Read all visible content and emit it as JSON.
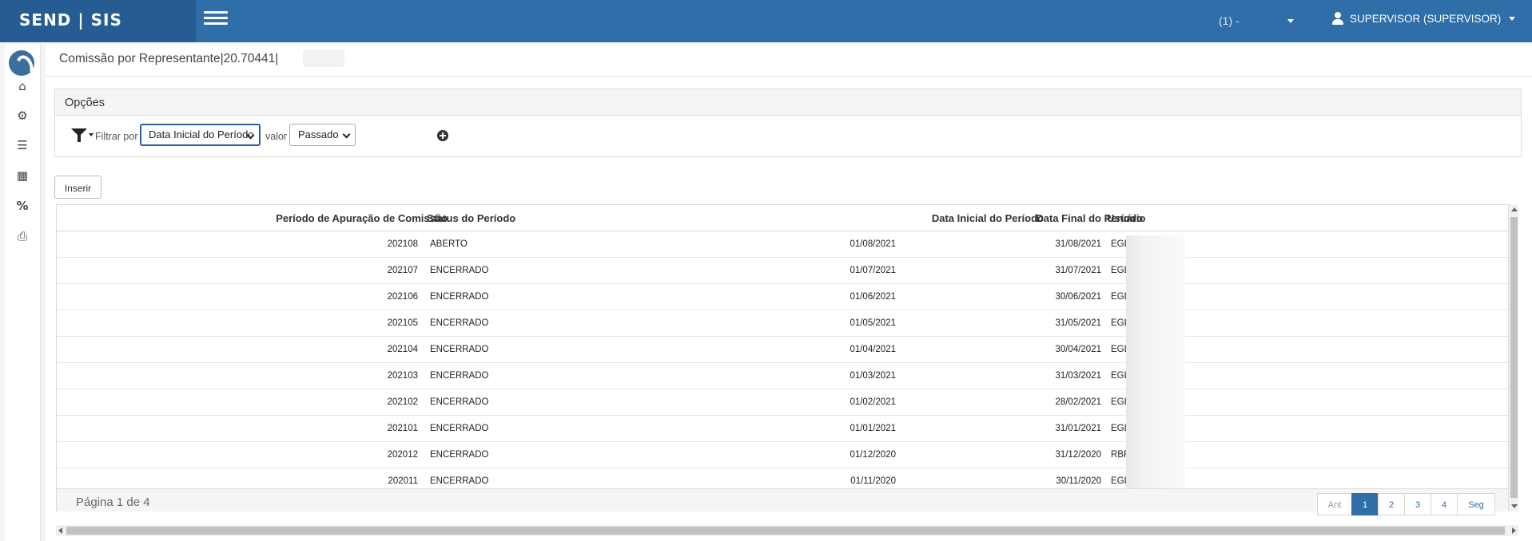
{
  "app": {
    "brand": "SEND | SIS"
  },
  "header": {
    "company": "(1) -",
    "user": "SUPERVISOR (SUPERVISOR)"
  },
  "sidebar": {
    "icons": [
      "logo-icon",
      "home-icon",
      "cogs-icon",
      "stack-icon",
      "calculator-icon",
      "percent-icon",
      "print-icon"
    ],
    "glyphs": {
      "home": "⌂",
      "cogs": "⚙",
      "stack": "☰",
      "calculator": "▦",
      "percent": "%",
      "print": "⎙"
    }
  },
  "page": {
    "title": "Comissão por Representante|20.70441|"
  },
  "options": {
    "heading": "Opções",
    "filter_label": "Filtrar por",
    "filter_field": "Data Inicial do Período",
    "value_label": "valor",
    "value_option": "Passado"
  },
  "toolbar": {
    "insert_label": "Inserir"
  },
  "table": {
    "columns": [
      "Período de Apuração de Comissão",
      "Status do Período",
      "Data Inicial do Período",
      "Data Final do Período",
      "Usuário"
    ],
    "rows": [
      {
        "periodo": "202108",
        "status": "ABERTO",
        "inicio": "01/08/2021",
        "fim": "31/08/2021",
        "usuario": "EGL"
      },
      {
        "periodo": "202107",
        "status": "ENCERRADO",
        "inicio": "01/07/2021",
        "fim": "31/07/2021",
        "usuario": "EGL"
      },
      {
        "periodo": "202106",
        "status": "ENCERRADO",
        "inicio": "01/06/2021",
        "fim": "30/06/2021",
        "usuario": "EGL"
      },
      {
        "periodo": "202105",
        "status": "ENCERRADO",
        "inicio": "01/05/2021",
        "fim": "31/05/2021",
        "usuario": "EGL"
      },
      {
        "periodo": "202104",
        "status": "ENCERRADO",
        "inicio": "01/04/2021",
        "fim": "30/04/2021",
        "usuario": "EGL"
      },
      {
        "periodo": "202103",
        "status": "ENCERRADO",
        "inicio": "01/03/2021",
        "fim": "31/03/2021",
        "usuario": "EGL"
      },
      {
        "periodo": "202102",
        "status": "ENCERRADO",
        "inicio": "01/02/2021",
        "fim": "28/02/2021",
        "usuario": "EGL"
      },
      {
        "periodo": "202101",
        "status": "ENCERRADO",
        "inicio": "01/01/2021",
        "fim": "31/01/2021",
        "usuario": "EGL"
      },
      {
        "periodo": "202012",
        "status": "ENCERRADO",
        "inicio": "01/12/2020",
        "fim": "31/12/2020",
        "usuario": "RBR"
      },
      {
        "periodo": "202011",
        "status": "ENCERRADO",
        "inicio": "01/11/2020",
        "fim": "30/11/2020",
        "usuario": "EGL"
      }
    ]
  },
  "footer": {
    "page_info": "Página 1 de 4",
    "pager": {
      "prev": "Ant",
      "pages": [
        "1",
        "2",
        "3",
        "4"
      ],
      "current": "1",
      "next": "Seg"
    }
  },
  "colors": {
    "navbar": "#2f6ea8",
    "brand_bg": "#255d92",
    "active_page": "#2f6ea8"
  }
}
